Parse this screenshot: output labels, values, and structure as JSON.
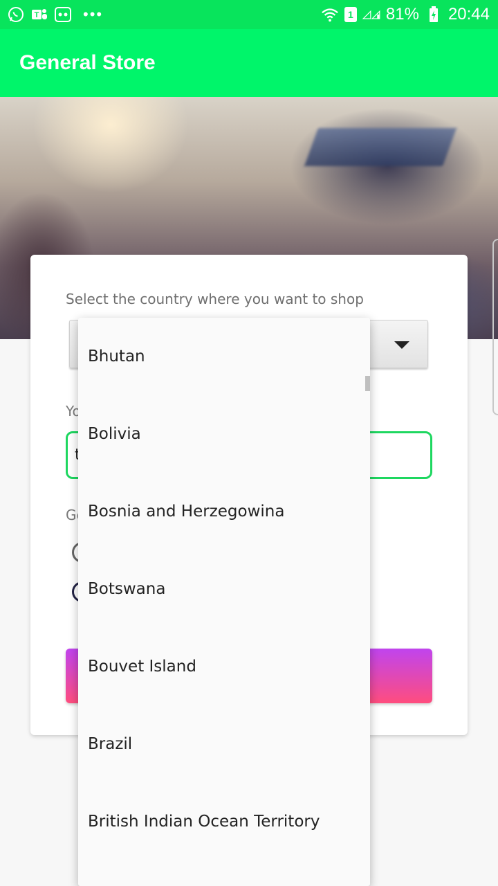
{
  "status_bar": {
    "battery": "81%",
    "time": "20:44",
    "sim_badge": "1",
    "icons": [
      "whatsapp-icon",
      "teams-icon",
      "chat-app-icon",
      "more-dots-icon",
      "wifi-icon",
      "signal-icon",
      "battery-charging-icon"
    ]
  },
  "app_bar": {
    "title": "General Store"
  },
  "form": {
    "country_label": "Select the country where you want to shop",
    "name_label_partial": "Yo",
    "name_value_partial": "t",
    "gender_label_partial": "Ge"
  },
  "dropdown": {
    "items": [
      "Bhutan",
      "Bolivia",
      "Bosnia and Herzegowina",
      "Botswana",
      "Bouvet Island",
      "Brazil",
      "British Indian Ocean Territory"
    ]
  },
  "colors": {
    "status_bar": "#08e45c",
    "app_bar": "#00f56a",
    "input_border": "#1ed760",
    "button_gradient_top": "#c044ee",
    "button_gradient_bottom": "#ff4d7e"
  }
}
